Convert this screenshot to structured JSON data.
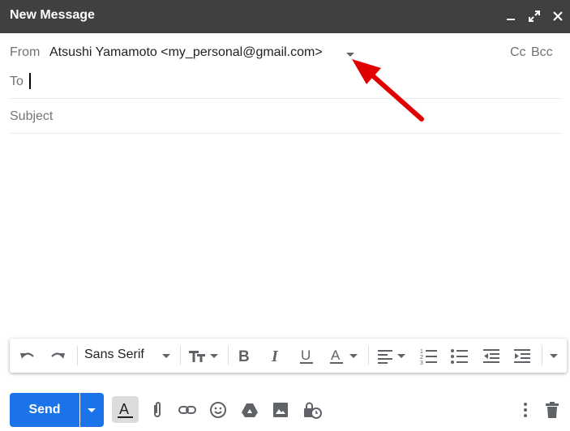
{
  "window": {
    "title": "New Message"
  },
  "header": {
    "from_label": "From",
    "from_value": "Atsushi Yamamoto <my_personal@gmail.com>",
    "cc_label": "Cc",
    "bcc_label": "Bcc"
  },
  "to": {
    "label": "To",
    "value": ""
  },
  "subject": {
    "placeholder": "Subject",
    "value": ""
  },
  "toolbar": {
    "font_name": "Sans Serif"
  },
  "footer": {
    "send_label": "Send"
  },
  "colors": {
    "title_bar": "#404040",
    "send_button": "#1a73e8",
    "arrow": "#e00000"
  }
}
